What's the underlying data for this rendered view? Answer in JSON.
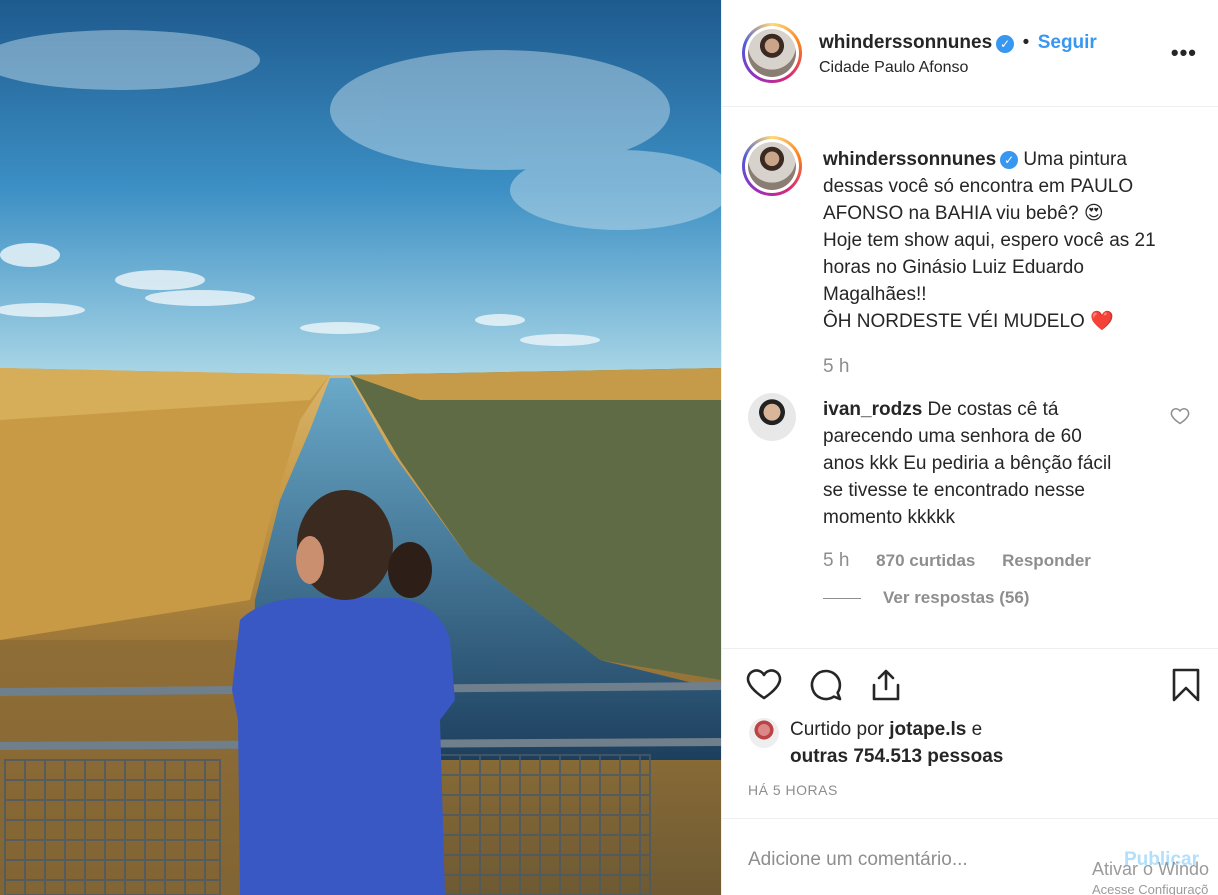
{
  "post": {
    "username": "whinderssonnunes",
    "follow_label": "Seguir",
    "location": "Cidade Paulo Afonso",
    "more_label": "•••",
    "caption_lines": [
      "Uma pintura",
      "dessas você só encontra em PAULO",
      "AFONSO na BAHIA viu bebê? 😍",
      "Hoje tem show aqui, espero você as 21",
      "horas no Ginásio Luiz Eduardo",
      "Magalhães!!",
      "ÔH NORDESTE VÉI MUDELO ❤️"
    ],
    "caption_time": "5 h"
  },
  "comment": {
    "username": "ivan_rodzs",
    "lines": [
      "De costas cê tá",
      "parecendo uma senhora de 60",
      "anos kkk Eu pediria a bênção fácil",
      "se tivesse te encontrado nesse",
      "momento kkkkk"
    ],
    "time": "5 h",
    "likes": "870 curtidas",
    "reply_label": "Responder",
    "view_replies": "Ver respostas (56)"
  },
  "likes": {
    "prefix": "Curtido por ",
    "liker": "jotape.ls",
    "suffix": " e",
    "others": "outras 754.513 pessoas"
  },
  "timestamp": "HÁ 5 HORAS",
  "add_comment": {
    "placeholder": "Adicione um comentário...",
    "publish_label": "Publicar"
  },
  "watermark": {
    "line1": "Ativar o Windo",
    "line2": "Acesse Configuraçõ"
  },
  "icons": {
    "verified": "verified-badge-icon",
    "like": "heart-icon",
    "comment": "comment-bubble-icon",
    "share": "share-icon",
    "save": "bookmark-icon"
  },
  "colors": {
    "accent": "#3897f0",
    "muted": "#8e8e8e",
    "heart": "#ed4956"
  }
}
